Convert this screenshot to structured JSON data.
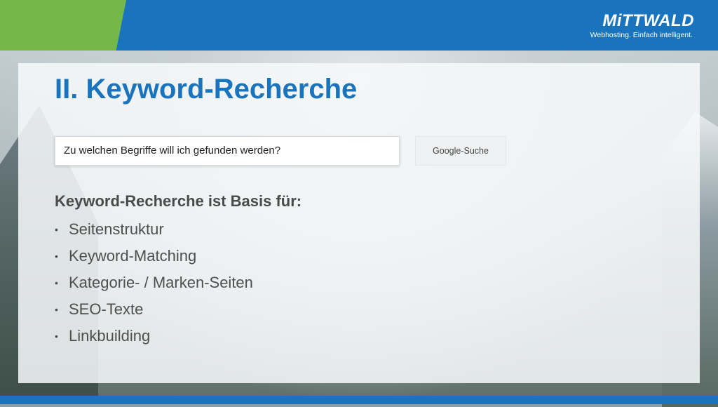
{
  "header": {
    "logo_text": "MiTTWALD",
    "tagline": "Webhosting. Einfach intelligent."
  },
  "slide": {
    "title": "II. Keyword-Recherche",
    "search": {
      "value": "Zu welchen Begriffe will ich gefunden werden?",
      "button_label": "Google-Suche"
    },
    "subheading": "Keyword-Recherche ist Basis für:",
    "bullets": [
      "Seitenstruktur",
      "Keyword-Matching",
      "Kategorie- / Marken-Seiten",
      "SEO-Texte",
      "Linkbuilding"
    ],
    "bullet_symbol": "•"
  },
  "colors": {
    "brand_blue": "#1a74bd",
    "brand_green": "#74b84a"
  }
}
